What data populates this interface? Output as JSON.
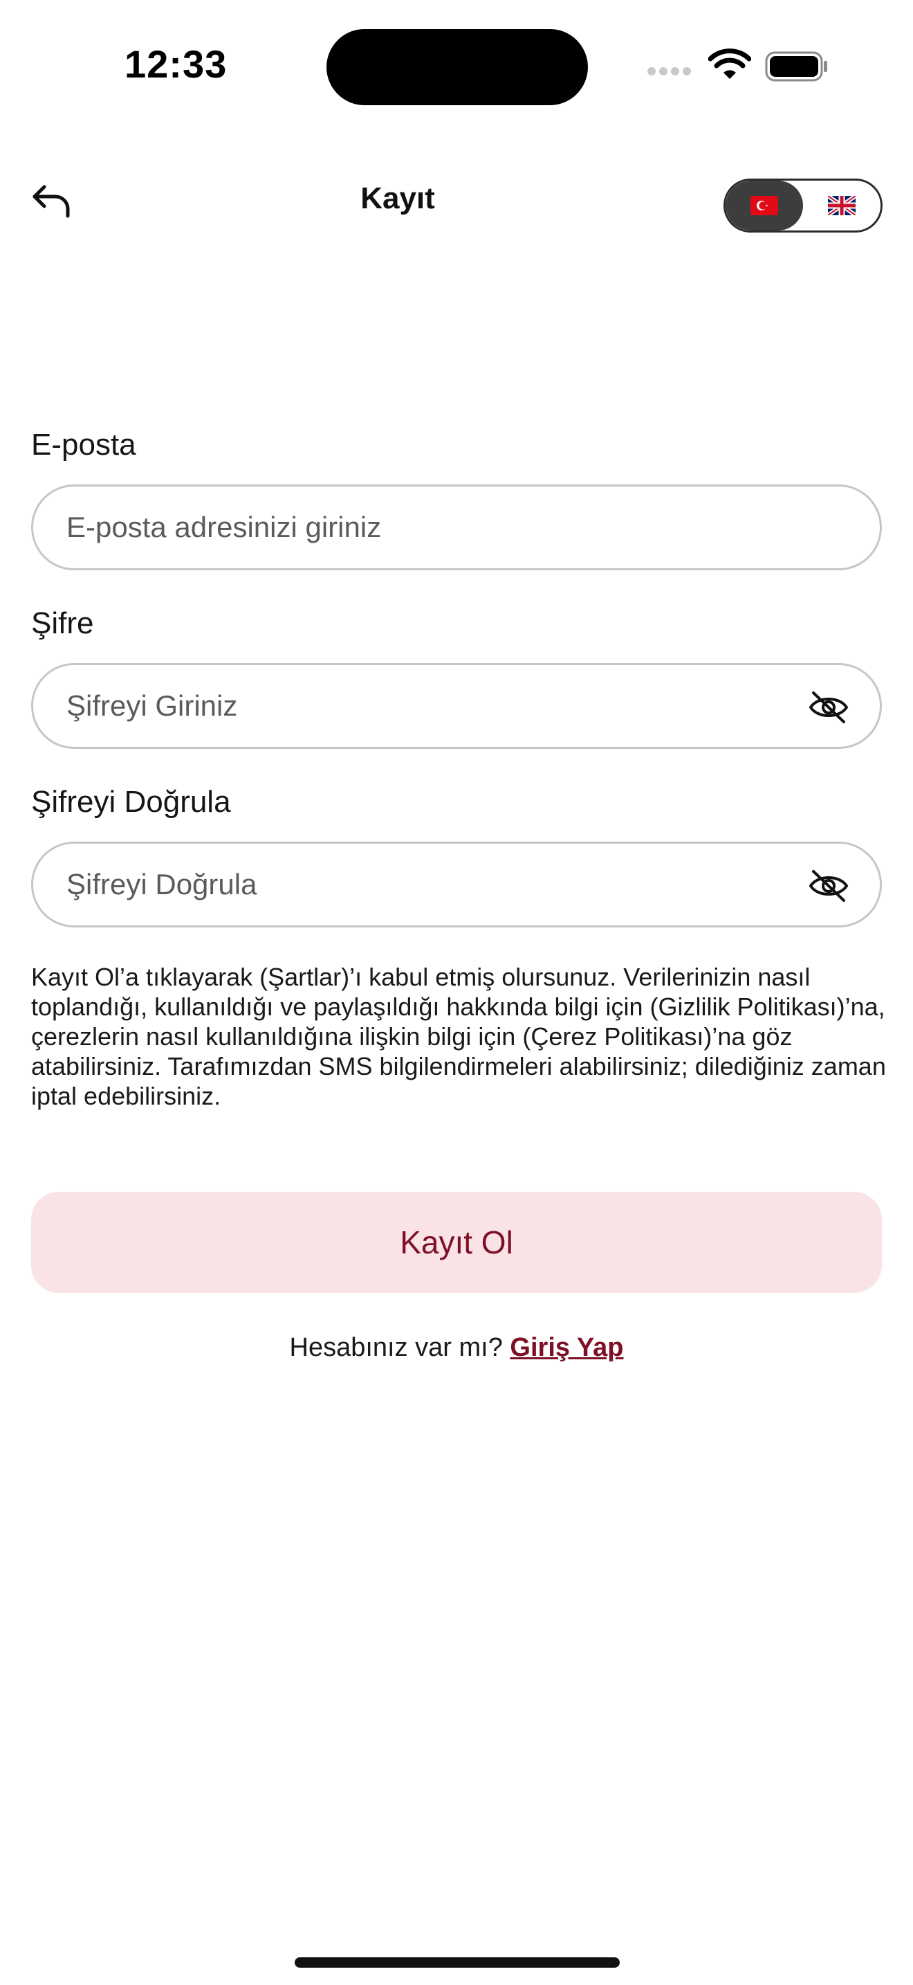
{
  "status_bar": {
    "time": "12:33"
  },
  "header": {
    "title": "Kayıt",
    "languages": [
      {
        "code": "tr",
        "flag_icon": "turkey-flag-icon",
        "active": true
      },
      {
        "code": "en",
        "flag_icon": "uk-flag-icon",
        "active": false
      }
    ]
  },
  "form": {
    "email": {
      "label": "E-posta",
      "placeholder": "E-posta adresinizi giriniz"
    },
    "password": {
      "label": "Şifre",
      "placeholder": "Şifreyi Giriniz"
    },
    "confirm_password": {
      "label": "Şifreyi Doğrula",
      "placeholder": "Şifreyi Doğrula"
    }
  },
  "terms_text": "Kayıt Ol’a tıklayarak (Şartlar)’ı kabul etmiş olursunuz. Verilerinizin nasıl toplandığı, kullanıldığı ve paylaşıldığı hakkında bilgi için (Gizlilik Politikası)’na, çerezlerin nasıl kullanıldığına ilişkin bilgi için (Çerez Politikası)’na göz atabilirsiniz. Tarafımızdan SMS bilgilendirmeleri alabilirsiniz; dilediğiniz zaman iptal edebilirsiniz.",
  "submit_label": "Kayıt Ol",
  "login_prompt": {
    "text": "Hesabınız var mı?",
    "link_label": "Giriş Yap"
  },
  "colors": {
    "accent": "#7d1024",
    "button_bg": "#fae3e6",
    "toggle_active_bg": "#3d3d3d"
  }
}
